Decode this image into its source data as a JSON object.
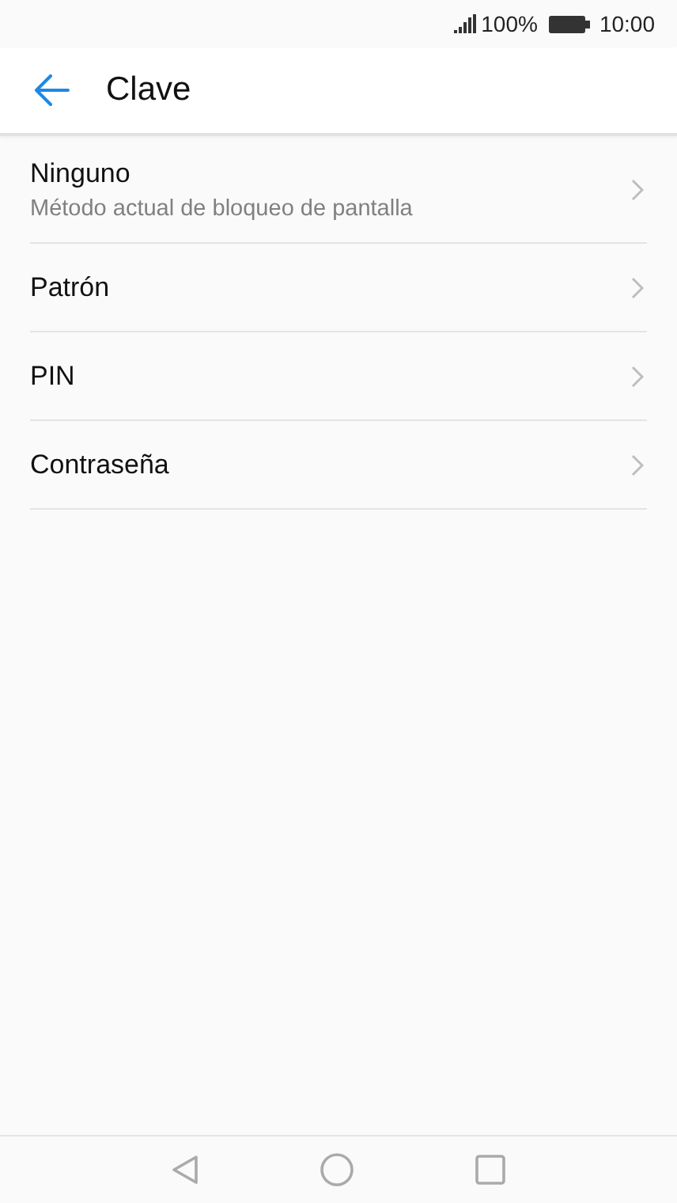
{
  "status_bar": {
    "battery_text": "100%",
    "time": "10:00"
  },
  "header": {
    "title": "Clave"
  },
  "items": [
    {
      "title": "Ninguno",
      "subtitle": "Método actual de bloqueo de pantalla"
    },
    {
      "title": "Patrón"
    },
    {
      "title": "PIN"
    },
    {
      "title": "Contraseña"
    }
  ]
}
